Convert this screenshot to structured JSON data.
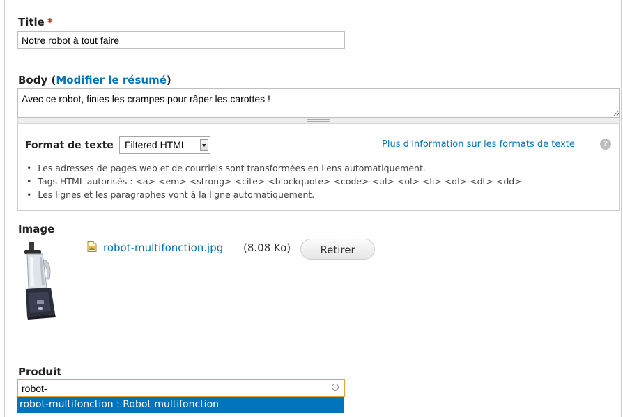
{
  "fields": {
    "title": {
      "label": "Title",
      "required_marker": "*",
      "value": "Notre robot à tout faire"
    },
    "body": {
      "label": "Body",
      "summary_open": " (",
      "summary_link": "Modifier le résumé",
      "summary_close": ")",
      "value": "Avec ce robot, finies les crampes pour râper les carottes !"
    },
    "format": {
      "label": "Format de texte",
      "selected": "Filtered HTML",
      "help_link": "Plus d'information sur les formats de texte",
      "help_icon": "?",
      "tips": [
        "Les adresses de pages web et de courriels sont transformées en liens automatiquement.",
        "Tags HTML autorisés : <a> <em> <strong> <cite> <blockquote> <code> <ul> <ol> <li> <dl> <dt> <dd>",
        "Les lignes et les paragraphes vont à la ligne automatiquement."
      ]
    },
    "image": {
      "label": "Image",
      "file_name": "robot-multifonction.jpg",
      "file_size": "(8.08 Ko)",
      "remove_label": "Retirer"
    },
    "produit": {
      "label": "Produit",
      "value": "robot-",
      "suggestions": [
        "robot-multifonction : Robot multifonction"
      ]
    }
  },
  "colors": {
    "link": "#0074bd",
    "required": "#dd2222",
    "autocomplete_bg": "#0074bd"
  },
  "icons": [
    "file-image-icon",
    "help-icon",
    "throbber-icon",
    "select-arrow-icon",
    "resize-grip-icon"
  ]
}
